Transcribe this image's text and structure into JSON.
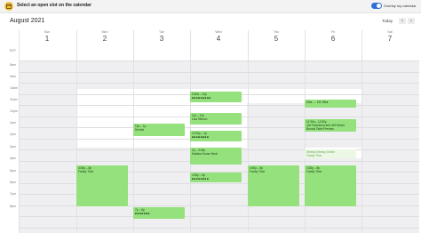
{
  "header": {
    "title": "Select an open slot on the calendar",
    "overlay_label": "Overlay my calendar"
  },
  "calendar": {
    "month": "August 2021",
    "today_label": "Today",
    "prev_glyph": "‹",
    "next_glyph": "›",
    "timezone": "EDT",
    "days": [
      {
        "name": "Sun",
        "num": "1"
      },
      {
        "name": "Mon",
        "num": "2"
      },
      {
        "name": "Tue",
        "num": "3"
      },
      {
        "name": "Wed",
        "num": "4"
      },
      {
        "name": "Thu",
        "num": "5"
      },
      {
        "name": "Fri",
        "num": "6"
      },
      {
        "name": "Sat",
        "num": "7"
      }
    ],
    "hours": [
      "8am",
      "9am",
      "10am",
      "11am",
      "12pm",
      "1pm",
      "2pm",
      "3pm",
      "4pm",
      "5pm",
      "6pm",
      "7pm",
      "8pm"
    ]
  },
  "events": {
    "tue_1": {
      "time": "12p – 1p",
      "title": "Dentist"
    },
    "tue_2": {
      "time": "7p – 8p",
      "title": "■■■■■■■"
    },
    "mon_1": {
      "time": "4:30p – 8p",
      "title": "Family Time"
    },
    "wed_1": {
      "time": "9:45a – 10p",
      "title": "■■■■■■■■■"
    },
    "wed_2": {
      "time": "11a – 12p",
      "title": "Lisa Stinson"
    },
    "wed_3": {
      "time": "12:30p – 1p",
      "title": "■■■■■■■■"
    },
    "wed_4": {
      "time": "2p – 3:30p",
      "title": "Kabaka House Meal"
    },
    "wed_5": {
      "time": "4:30p – 5p",
      "title": "■■■■■■■■"
    },
    "thu_1": {
      "time": "4:30p – 8p",
      "title": "Family Time"
    },
    "fri_1": {
      "time": "10a – 10:30a",
      "title": "■■■■■■■■■"
    },
    "fri_2": {
      "time": "11:30a – 12:30p",
      "title": "Joe Fasulbova and Jeff Hanes",
      "sub": "Brunch Table Preview"
    },
    "fri_3": {
      "time": "Weekly Meetup Online",
      "title": "Family Time"
    },
    "fri_4": {
      "time": "4:30p – 8p",
      "title": "Family Time"
    }
  }
}
